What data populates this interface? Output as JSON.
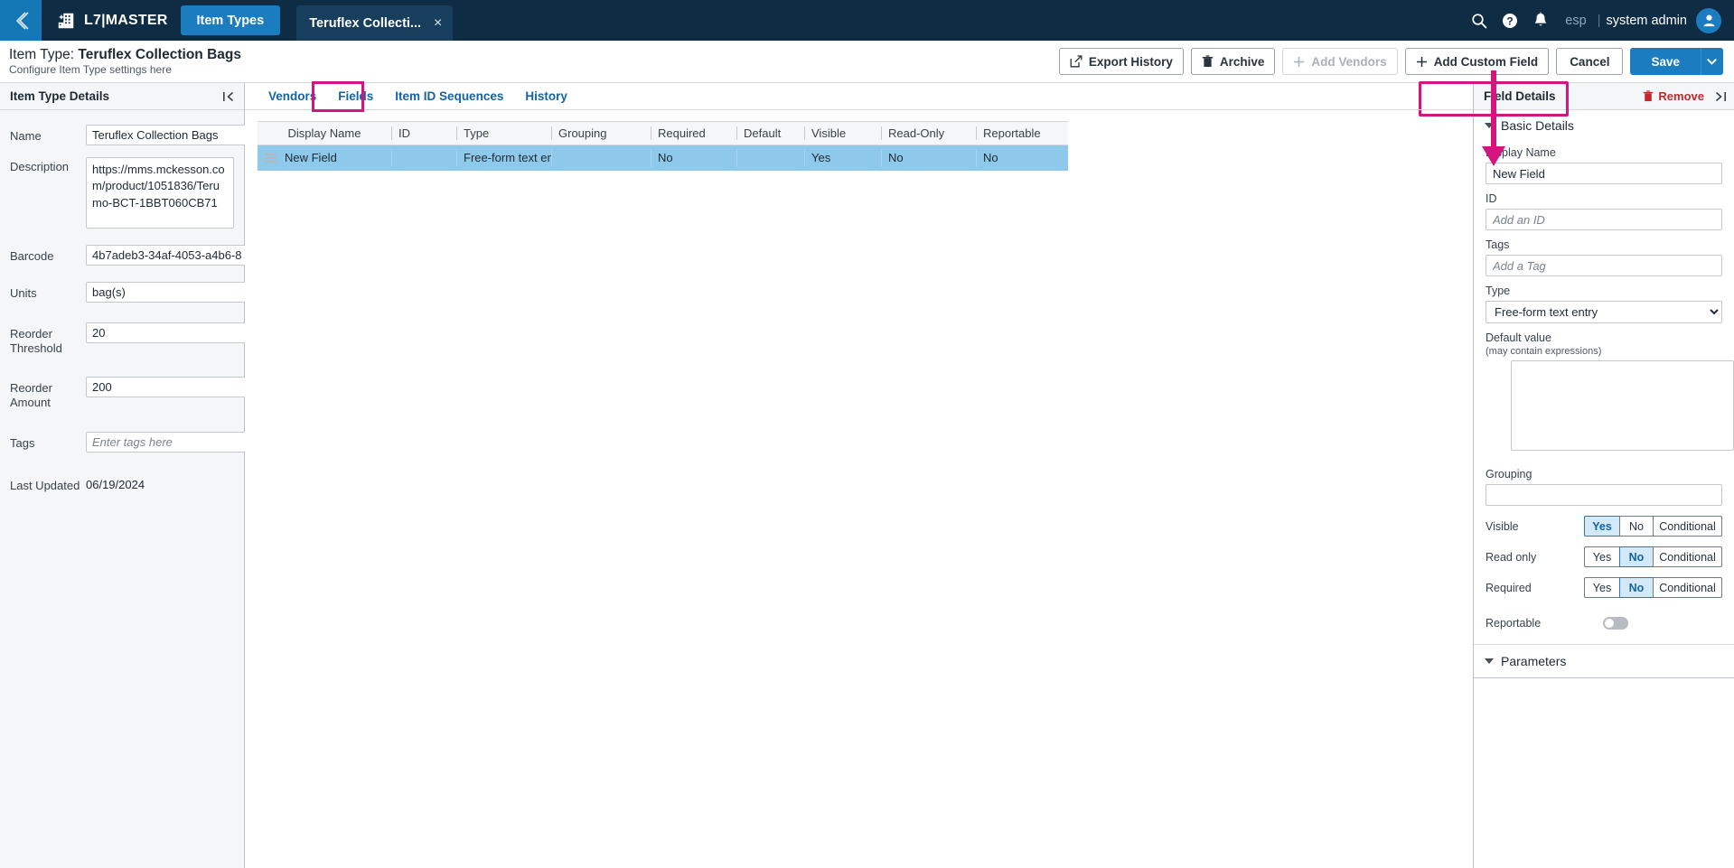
{
  "topbar": {
    "back_icon": "chevron-left-icon",
    "brand": "L7|MASTER",
    "brand_icon": "building-icon",
    "nav_pill": "Item Types",
    "open_tab": "Teruflex Collecti...",
    "tab_close": "×",
    "search_icon": "search-icon",
    "help_icon": "help-icon",
    "bell_icon": "notification-bell-icon",
    "locale": "esp",
    "separator": "|",
    "user": "system admin",
    "avatar_icon": "user-avatar-icon"
  },
  "page": {
    "title_prefix": "Item Type: ",
    "title_value": "Teruflex Collection Bags",
    "subtitle": "Configure Item Type settings here"
  },
  "toolbar": {
    "export_history": "Export History",
    "export_history_icon": "external-link-icon",
    "archive": "Archive",
    "archive_icon": "trash-icon",
    "add_vendors": "Add Vendors",
    "add_vendors_icon": "plus-icon",
    "add_custom_field": "Add Custom Field",
    "add_custom_field_icon": "plus-icon",
    "cancel": "Cancel",
    "save": "Save",
    "save_caret_icon": "chevron-down-icon"
  },
  "left_panel": {
    "title": "Item Type Details",
    "collapse_icon": "collapse-left-icon",
    "fields": [
      {
        "label": "Name",
        "value": "Teruflex Collection Bags"
      },
      {
        "label": "Description",
        "value": "https://mms.mckesson.com/product/1051836/Terumo-BCT-1BBT060CB71"
      },
      {
        "label": "Barcode",
        "value": "4b7adeb3-34af-4053-a4b6-8"
      },
      {
        "label": "Units",
        "value": "bag(s)"
      },
      {
        "label": "Reorder Threshold",
        "value": "20"
      },
      {
        "label": "Reorder Amount",
        "value": "200"
      },
      {
        "label": "Tags",
        "value": "",
        "placeholder": "Enter tags here"
      },
      {
        "label": "Last Updated",
        "value": "06/19/2024"
      }
    ]
  },
  "tabs": {
    "items": [
      "Vendors",
      "Fields",
      "Item ID Sequences",
      "History"
    ],
    "active": "Fields"
  },
  "grid": {
    "columns": [
      "Display Name",
      "ID",
      "Type",
      "Grouping",
      "Required",
      "Default",
      "Visible",
      "Read-Only",
      "Reportable"
    ],
    "rows": [
      {
        "display_name": "New Field",
        "id": "",
        "type": "Free-form text entry",
        "grouping": "",
        "required": "No",
        "default": "",
        "visible": "Yes",
        "read_only": "No",
        "reportable": "No",
        "drag_icon": "drag-handle-icon"
      }
    ]
  },
  "right_panel": {
    "title": "Field Details",
    "remove": "Remove",
    "remove_icon": "trash-icon",
    "expand_icon": "expand-right-icon",
    "basic_details": "Basic Details",
    "display_name_label": "Display Name",
    "display_name_value": "New Field",
    "id_label": "ID",
    "id_placeholder": "Add an ID",
    "tags_label": "Tags",
    "tags_placeholder": "Add a Tag",
    "type_label": "Type",
    "type_value": "Free-form text entry",
    "default_value_label": "Default value",
    "default_value_hint": "(may contain expressions)",
    "default_value": "",
    "grouping_label": "Grouping",
    "grouping_value": "",
    "visible_label": "Visible",
    "visible_selected": "Yes",
    "read_only_label": "Read only",
    "read_only_selected": "No",
    "required_label": "Required",
    "required_selected": "No",
    "seg_options": [
      "Yes",
      "No",
      "Conditional"
    ],
    "reportable_label": "Reportable",
    "reportable_on": false,
    "parameters": "Parameters"
  },
  "colors": {
    "navy": "#0e2d45",
    "blue": "#1b7cc0",
    "link_blue": "#1464a5",
    "highlight_magenta": "#d4147f",
    "row_selected": "#8ec8ea",
    "remove_red": "#c1272d"
  }
}
